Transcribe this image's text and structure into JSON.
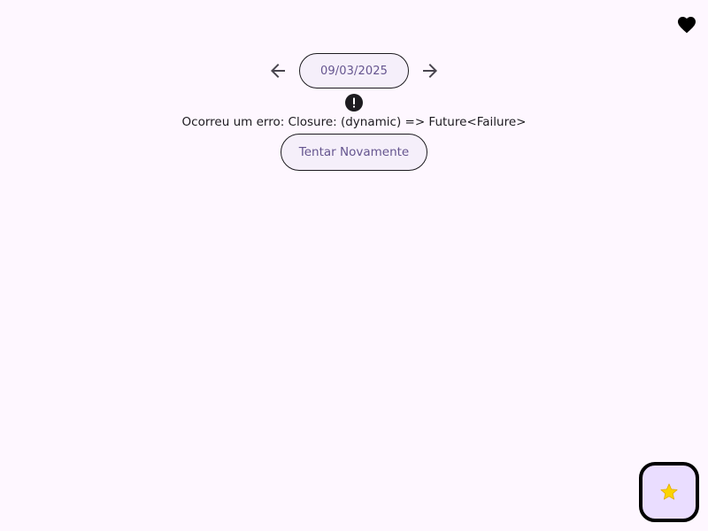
{
  "header": {
    "favorite_icon": "heart-icon"
  },
  "date_nav": {
    "prev_icon": "arrow-left-icon",
    "date": "09/03/2025",
    "next_icon": "arrow-right-icon"
  },
  "error": {
    "icon": "error-icon",
    "message": "Ocorreu um erro: Closure: (dynamic) => Future<Failure>"
  },
  "retry_button": {
    "label": "Tentar Novamente"
  },
  "fab": {
    "icon": "star-icon",
    "glyph": "⭐"
  },
  "colors": {
    "background": "#fef7ff",
    "accent_text": "#65558f",
    "pill_background": "#f5effa",
    "fab_background": "#eaddff",
    "star": "#fbd400"
  }
}
